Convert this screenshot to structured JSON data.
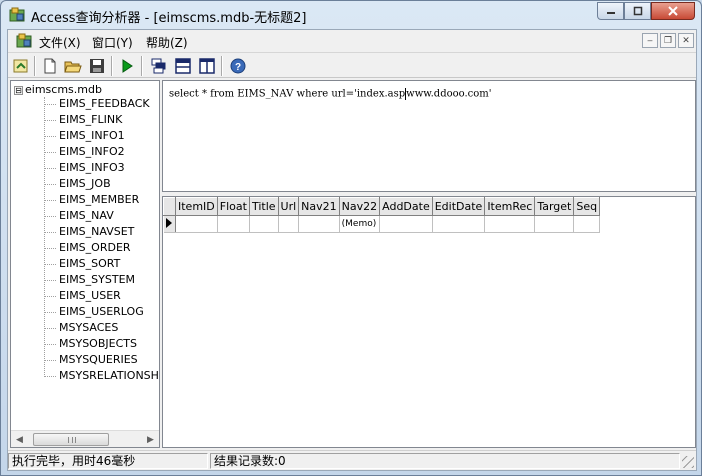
{
  "window": {
    "title": "Access查询分析器 - [eimscms.mdb-无标题2]",
    "controls": [
      "minimize-icon",
      "maximize-icon",
      "close-icon"
    ]
  },
  "menu": {
    "items": [
      "文件(X)",
      "窗口(Y)",
      "帮助(Z)"
    ],
    "mdi_controls": [
      "minimize-icon",
      "restore-icon",
      "close-icon"
    ]
  },
  "toolbar": {
    "buttons": [
      "connect-icon",
      "new-icon",
      "open-icon",
      "save-icon",
      "run-icon",
      "layout-tile-icon",
      "layout-horizontal-icon",
      "layout-vertical-icon",
      "help-icon"
    ]
  },
  "tree": {
    "root": "eimscms.mdb",
    "expander": "⊟",
    "tables": [
      "EIMS_FEEDBACK",
      "EIMS_FLINK",
      "EIMS_INFO1",
      "EIMS_INFO2",
      "EIMS_INFO3",
      "EIMS_JOB",
      "EIMS_MEMBER",
      "EIMS_NAV",
      "EIMS_NAVSET",
      "EIMS_ORDER",
      "EIMS_SORT",
      "EIMS_SYSTEM",
      "EIMS_USER",
      "EIMS_USERLOG",
      "MSYSACES",
      "MSYSOBJECTS",
      "MSYSQUERIES",
      "MSYSRELATIONSHI"
    ]
  },
  "editor": {
    "sql_before_caret": "select * from EIMS_NAV where url='index.asp",
    "sql_after_caret": "www.ddooo.com'"
  },
  "results": {
    "columns": [
      "ItemID",
      "Float",
      "Title",
      "Url",
      "Nav21",
      "Nav22",
      "AddDate",
      "EditDate",
      "ItemRec",
      "Target",
      "Seq"
    ],
    "rows": [
      [
        "",
        "",
        "",
        "",
        "",
        "(Memo)",
        "",
        "",
        "",
        "",
        ""
      ]
    ]
  },
  "status": {
    "left": "执行完毕，用时46毫秒",
    "right": "结果记录数:0"
  },
  "colors": {
    "titlebar": "#c4d6ea",
    "close_button": "#c84a36",
    "run_green": "#0a9a1a"
  }
}
